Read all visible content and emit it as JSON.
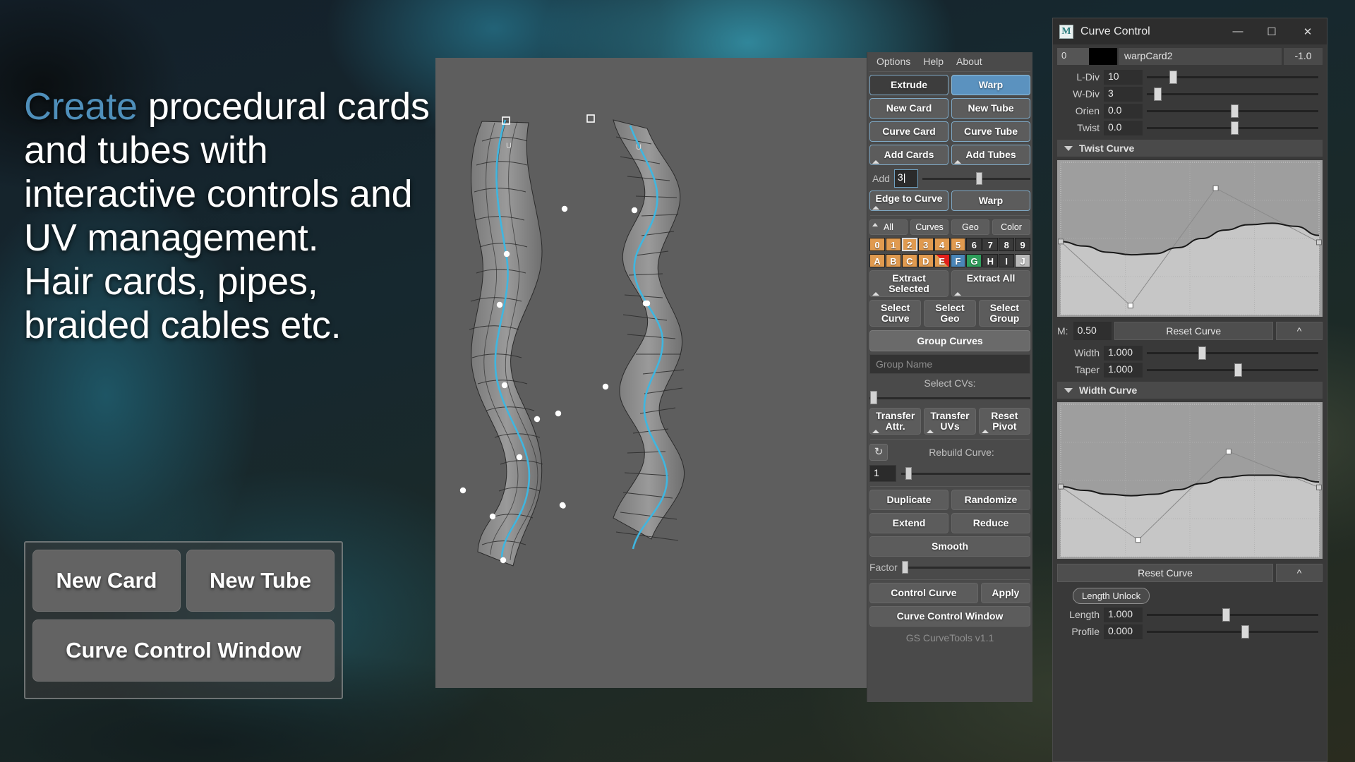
{
  "promo": {
    "headline_accent": "Create",
    "headline_rest": " procedural cards and tubes with interactive controls and UV management.",
    "headline_line2": "Hair cards, pipes, braided cables etc.",
    "accent_color": "#4f8fba",
    "buttons": {
      "new_card": "New Card",
      "new_tube": "New Tube",
      "curve_control_window": "Curve Control Window"
    }
  },
  "tools": {
    "menu": [
      "Options",
      "Help",
      "About"
    ],
    "mode_buttons": [
      {
        "label": "Extrude",
        "state": "inactive"
      },
      {
        "label": "Warp",
        "state": "selected"
      }
    ],
    "create_row": [
      "New Card",
      "New Tube"
    ],
    "curve_row": [
      "Curve Card",
      "Curve Tube"
    ],
    "add_row": [
      "Add Cards",
      "Add Tubes"
    ],
    "add_field": {
      "label": "Add",
      "value": "3"
    },
    "edge_row": [
      "Edge to Curve",
      "Warp"
    ],
    "filter_row": [
      "All",
      "Curves",
      "Geo",
      "Color"
    ],
    "grid_row_1": [
      {
        "label": "0",
        "color": "orange"
      },
      {
        "label": "1",
        "color": "orange"
      },
      {
        "label": "2",
        "color": "orange",
        "active": true
      },
      {
        "label": "3",
        "color": "orange"
      },
      {
        "label": "4",
        "color": "orange"
      },
      {
        "label": "5",
        "color": "orange"
      },
      {
        "label": "6",
        "color": "dark"
      },
      {
        "label": "7",
        "color": "dark"
      },
      {
        "label": "8",
        "color": "dark"
      },
      {
        "label": "9",
        "color": "dark"
      }
    ],
    "grid_row_2": [
      {
        "label": "A",
        "color": "orange"
      },
      {
        "label": "B",
        "color": "orange"
      },
      {
        "label": "C",
        "color": "orange"
      },
      {
        "label": "D",
        "color": "orange"
      },
      {
        "label": "E",
        "color": "orange",
        "split": "red"
      },
      {
        "label": "F",
        "color": "blue"
      },
      {
        "label": "G",
        "color": "green"
      },
      {
        "label": "H",
        "color": "dark"
      },
      {
        "label": "I",
        "color": "dark"
      },
      {
        "label": "J",
        "color": "grey"
      }
    ],
    "extract_row": [
      "Extract Selected",
      "Extract All"
    ],
    "select_row": [
      "Select Curve",
      "Select Geo",
      "Select Group"
    ],
    "group_curves": "Group Curves",
    "group_name_placeholder": "Group Name",
    "select_cvs_label": "Select CVs:",
    "transfer_row": [
      "Transfer Attr.",
      "Transfer UVs",
      "Reset Pivot"
    ],
    "rebuild_label": "Rebuild Curve:",
    "rebuild_value": "1",
    "refresh_icon": "↻",
    "dup_row": [
      "Duplicate",
      "Randomize"
    ],
    "ext_row": [
      "Extend",
      "Reduce"
    ],
    "smooth": "Smooth",
    "factor_label": "Factor",
    "control_row": [
      "Control Curve",
      "Apply"
    ],
    "curve_control_window": "Curve Control Window",
    "version": "GS CurveTools v1.1",
    "colors": {
      "panel_bg": "#4a4a4a",
      "accent_blue": "#5b92bf",
      "orange": "#e09a4f",
      "red": "#e2211c",
      "green": "#2e9e5b",
      "blue": "#4a86b8"
    }
  },
  "curve_control": {
    "title": "Curve Control",
    "logo_letter": "M",
    "window_buttons": {
      "minimize": "—",
      "maximize": "☐",
      "close": "✕"
    },
    "identity": {
      "index": "0",
      "swatch_color": "#000000",
      "name": "warpCard2",
      "value": "-1.0"
    },
    "params": [
      {
        "label": "L-Div",
        "value": "10",
        "knob_pct": 13
      },
      {
        "label": "W-Div",
        "value": "3",
        "knob_pct": 4
      },
      {
        "label": "Orien",
        "value": "0.0",
        "knob_pct": 50
      },
      {
        "label": "Twist",
        "value": "0.0",
        "knob_pct": 50
      }
    ],
    "twist_section": {
      "title": "Twist Curve",
      "reset_label": "Reset Curve",
      "up_label": "^",
      "m_label": "M:",
      "m_value": "0.50"
    },
    "width_taper": [
      {
        "label": "Width",
        "value": "1.000",
        "knob_pct": 30
      },
      {
        "label": "Taper",
        "value": "1.000",
        "knob_pct": 51
      }
    ],
    "width_section": {
      "title": "Width Curve",
      "reset_label": "Reset Curve",
      "up_label": "^"
    },
    "length_lock_button": "Length Unlock",
    "length_params": [
      {
        "label": "Length",
        "value": "1.000",
        "knob_pct": 44
      },
      {
        "label": "Profile",
        "value": "0.000",
        "knob_pct": 55
      }
    ]
  },
  "chart_data": [
    {
      "type": "line",
      "title": "Twist Curve",
      "x": [
        0.0,
        0.27,
        0.6,
        1.0
      ],
      "y": [
        0.48,
        0.06,
        0.83,
        0.475
      ],
      "control_points": [
        {
          "x": 0.0,
          "y": 0.48
        },
        {
          "x": 0.27,
          "y": 0.06
        },
        {
          "x": 0.6,
          "y": 0.83
        },
        {
          "x": 1.0,
          "y": 0.475
        }
      ],
      "curve_samples_y": [
        0.48,
        0.45,
        0.41,
        0.393,
        0.4,
        0.44,
        0.5,
        0.555,
        0.59,
        0.6,
        0.58,
        0.52
      ],
      "xlim": [
        0,
        1
      ],
      "ylim": [
        0,
        1
      ],
      "grid": true,
      "xlabel": "",
      "ylabel": ""
    },
    {
      "type": "line",
      "title": "Width Curve",
      "x": [
        0.0,
        0.3,
        0.65,
        1.0
      ],
      "y": [
        0.46,
        0.11,
        0.69,
        0.455
      ],
      "control_points": [
        {
          "x": 0.0,
          "y": 0.46
        },
        {
          "x": 0.3,
          "y": 0.11
        },
        {
          "x": 0.65,
          "y": 0.69
        },
        {
          "x": 1.0,
          "y": 0.455
        }
      ],
      "curve_samples_y": [
        0.46,
        0.435,
        0.41,
        0.4,
        0.41,
        0.44,
        0.48,
        0.52,
        0.535,
        0.535,
        0.52,
        0.49
      ],
      "xlim": [
        0,
        1
      ],
      "ylim": [
        0,
        1
      ],
      "grid": true,
      "xlabel": "",
      "ylabel": ""
    }
  ]
}
